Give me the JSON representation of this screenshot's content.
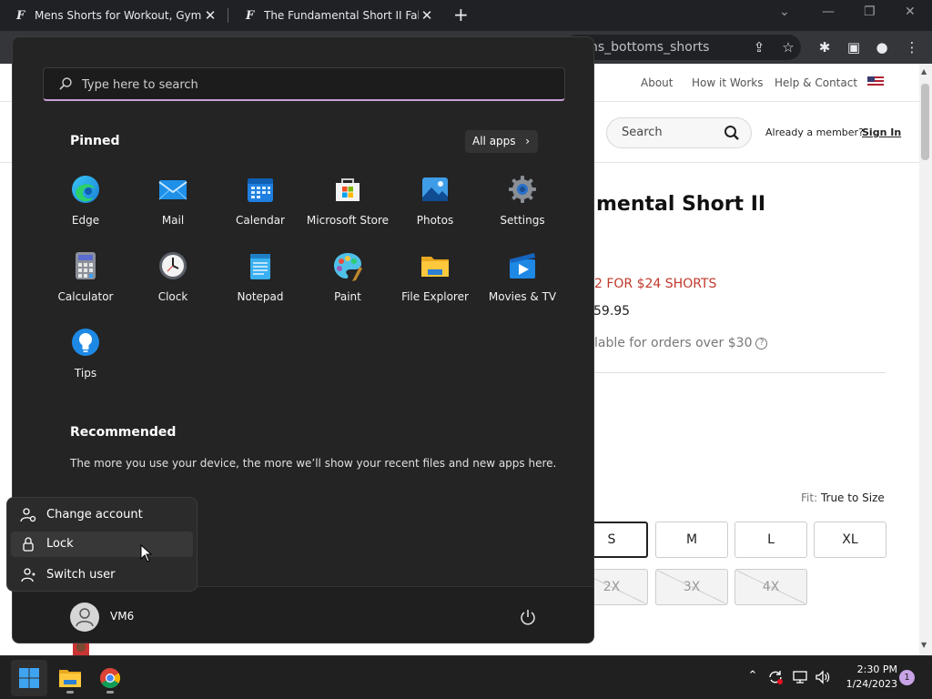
{
  "browser": {
    "tabs": [
      {
        "title": "Mens Shorts for Workout, Gym &",
        "active": false
      },
      {
        "title": "The Fundamental Short II Fableti",
        "active": true
      }
    ],
    "url_visible": "ns_bottoms_shorts"
  },
  "website": {
    "nav": [
      "About",
      "How it Works",
      "Help & Contact"
    ],
    "search_placeholder": "Search",
    "member_prompt": "Already a member?",
    "sign_in": "Sign In",
    "product_title_partial": "mental Short II",
    "promo_partial": "2 FOR $24 SHORTS",
    "price_partial": "59.95",
    "availability_partial": "lable for orders over $30",
    "fit_label": "Fit:",
    "fit_value": "True to Size",
    "sizes_row1": [
      "S",
      "M",
      "L",
      "XL"
    ],
    "sizes_row2": [
      "2X",
      "3X",
      "4X"
    ],
    "selected_size": "S"
  },
  "start_menu": {
    "search_placeholder": "Type here to search",
    "pinned_heading": "Pinned",
    "all_apps_label": "All apps",
    "pinned_apps": [
      {
        "name": "Edge",
        "icon": "edge-icon"
      },
      {
        "name": "Mail",
        "icon": "mail-icon"
      },
      {
        "name": "Calendar",
        "icon": "calendar-icon"
      },
      {
        "name": "Microsoft Store",
        "icon": "store-icon"
      },
      {
        "name": "Photos",
        "icon": "photos-icon"
      },
      {
        "name": "Settings",
        "icon": "settings-icon"
      },
      {
        "name": "Calculator",
        "icon": "calculator-icon"
      },
      {
        "name": "Clock",
        "icon": "clock-icon"
      },
      {
        "name": "Notepad",
        "icon": "notepad-icon"
      },
      {
        "name": "Paint",
        "icon": "paint-icon"
      },
      {
        "name": "File Explorer",
        "icon": "folder-icon"
      },
      {
        "name": "Movies & TV",
        "icon": "movies-icon"
      },
      {
        "name": "Tips",
        "icon": "tips-icon"
      }
    ],
    "recommended_heading": "Recommended",
    "recommended_text": "The more you use your device, the more we’ll show your recent files and new apps here.",
    "user_name": "VM6",
    "user_menu": [
      {
        "label": "Change account settings",
        "icon": "account-settings-icon"
      },
      {
        "label": "Lock",
        "icon": "lock-icon"
      },
      {
        "label": "Switch user",
        "icon": "switch-user-icon"
      }
    ]
  },
  "taskbar": {
    "time": "2:30 PM",
    "date": "1/24/2023",
    "notification_count": "1"
  },
  "colors": {
    "start_bg": "#242424",
    "search_accent": "#c9a0d8",
    "promo_red": "#c0392b",
    "taskbar_bg": "#202020"
  }
}
